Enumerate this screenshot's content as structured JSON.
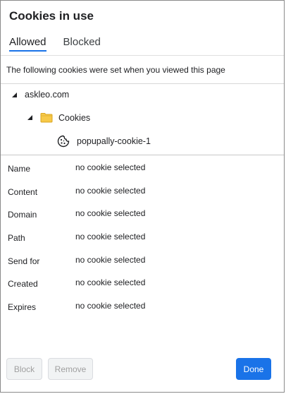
{
  "dialog": {
    "title": "Cookies in use"
  },
  "tabs": [
    {
      "label": "Allowed",
      "active": true
    },
    {
      "label": "Blocked",
      "active": false
    }
  ],
  "intro_text": "The following cookies were set when you viewed this page",
  "tree": {
    "site": "askleo.com",
    "folder": "Cookies",
    "cookie": "popupally-cookie-1"
  },
  "details": [
    {
      "label": "Name",
      "value": "no cookie selected"
    },
    {
      "label": "Content",
      "value": "no cookie selected"
    },
    {
      "label": "Domain",
      "value": "no cookie selected"
    },
    {
      "label": "Path",
      "value": "no cookie selected"
    },
    {
      "label": "Send for",
      "value": "no cookie selected"
    },
    {
      "label": "Created",
      "value": "no cookie selected"
    },
    {
      "label": "Expires",
      "value": "no cookie selected"
    }
  ],
  "buttons": {
    "block": "Block",
    "remove": "Remove",
    "done": "Done"
  },
  "icons": {
    "tree_expanded": "triangle-expanded-icon",
    "folder": "folder-icon",
    "cookie": "cookie-icon"
  },
  "colors": {
    "accent": "#1a73e8",
    "folder": "#f7c948",
    "disabled_text": "#a0a0a0"
  }
}
